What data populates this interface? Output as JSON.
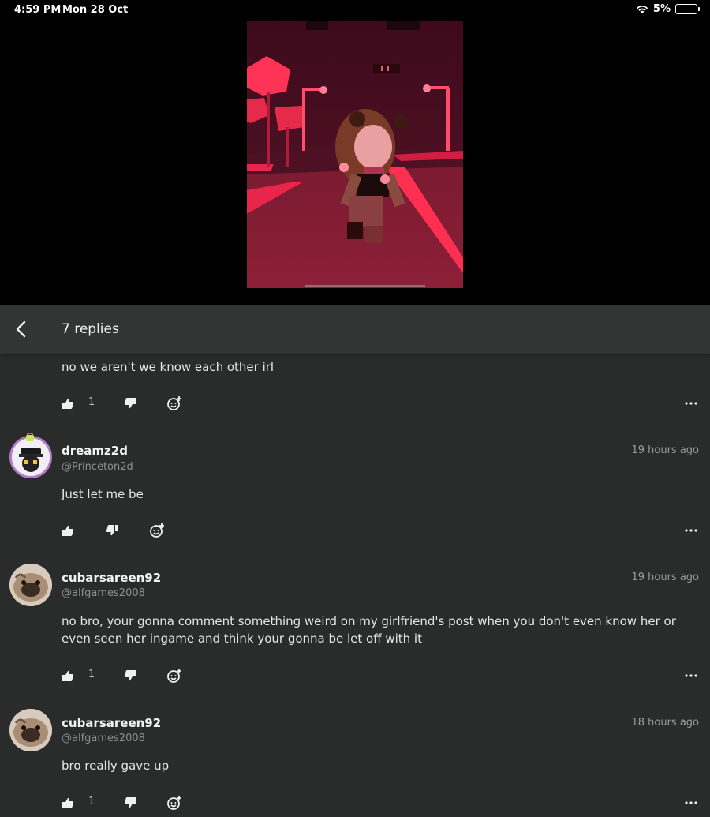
{
  "status_bar": {
    "time": "4:59 PM",
    "date": "Mon 28 Oct",
    "battery": "5%",
    "battery_level": 0.05,
    "icons": [
      "wifi-icon",
      "battery-icon"
    ]
  },
  "header": {
    "title": "7 replies",
    "back_icon": "chevron-left-icon"
  },
  "comments": [
    {
      "text": "no we aren't we know each other irl",
      "likes": "1"
    },
    {
      "username": "dreamz2d",
      "handle": "@Princeton2d",
      "time": "19 hours ago",
      "text": "Just let me be",
      "likes": ""
    },
    {
      "username": "cubarsareen92",
      "handle": "@alfgames2008",
      "time": "19 hours ago",
      "text": "no bro, your gonna comment something weird on my girlfriend's post when you don't even know her or even seen her ingame and think your gonna be let off with it",
      "likes": "1"
    },
    {
      "username": "cubarsareen92",
      "handle": "@alfgames2008",
      "time": "18 hours ago",
      "text": "bro really gave up",
      "likes": "1"
    }
  ],
  "colors": {
    "background": "#2a2c2c",
    "header": "#333535",
    "accent_red": "#e8254a"
  }
}
